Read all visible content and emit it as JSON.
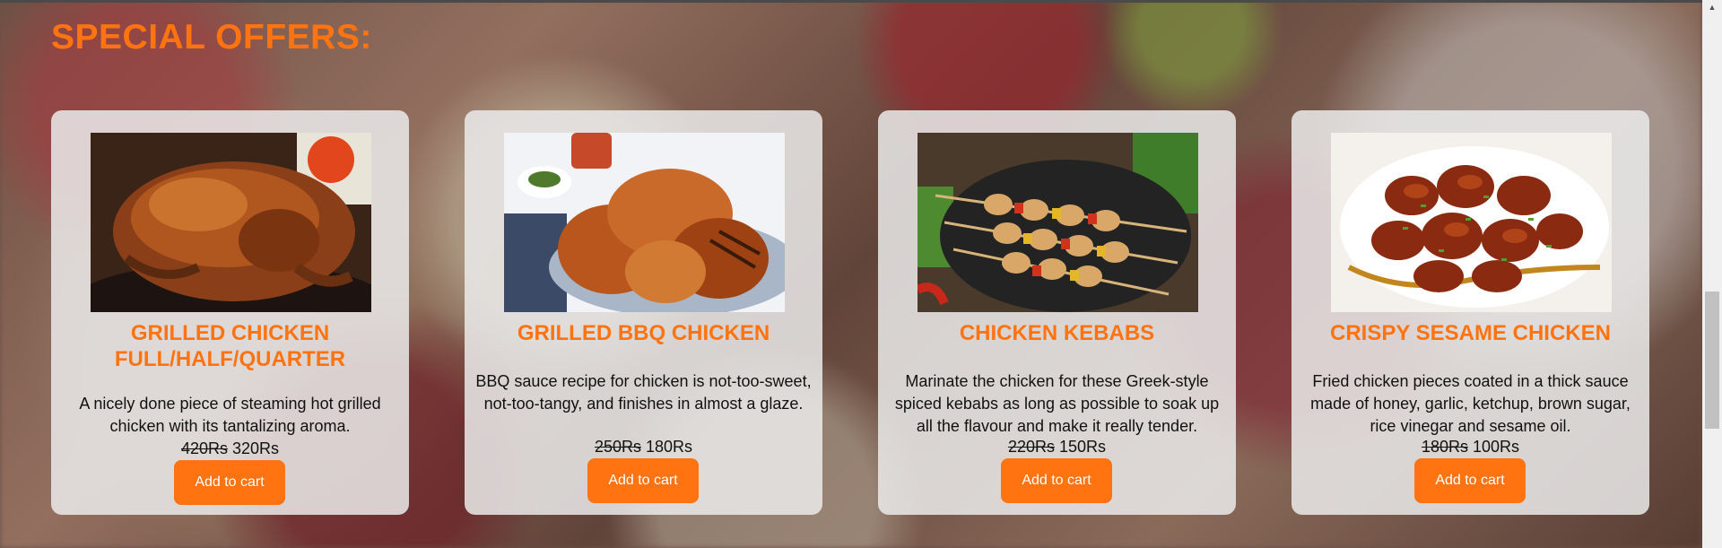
{
  "page": {
    "heading": "SPECIAL OFFERS:"
  },
  "offers": [
    {
      "name": "GRILLED CHICKEN FULL/HALF/QUARTER",
      "description": "A nicely done piece of steaming hot grilled chicken with its tantalizing aroma.",
      "old_price": "420Rs",
      "new_price": "320Rs",
      "button": "Add to cart"
    },
    {
      "name": "GRILLED BBQ CHICKEN",
      "description": "BBQ sauce recipe for chicken is not-too-sweet, not-too-tangy, and finishes in almost a glaze.",
      "old_price": "250Rs",
      "new_price": "180Rs",
      "button": "Add to cart"
    },
    {
      "name": "CHICKEN KEBABS",
      "description": "Marinate the chicken for these Greek-style spiced kebabs as long as possible to soak up all the flavour and make it really tender.",
      "old_price": "220Rs",
      "new_price": "150Rs",
      "button": "Add to cart"
    },
    {
      "name": "CRISPY SESAME CHICKEN",
      "description": "Fried chicken pieces coated in a thick sauce made of honey, garlic, ketchup, brown sugar, rice vinegar and sesame oil.",
      "old_price": "180Rs",
      "new_price": "100Rs",
      "button": "Add to cart"
    }
  ],
  "colors": {
    "accent": "#ff7311",
    "card_background": "#ebebeb",
    "button_text": "#ffffff"
  },
  "icons": {
    "scroll_up": "triangle-up-icon"
  }
}
